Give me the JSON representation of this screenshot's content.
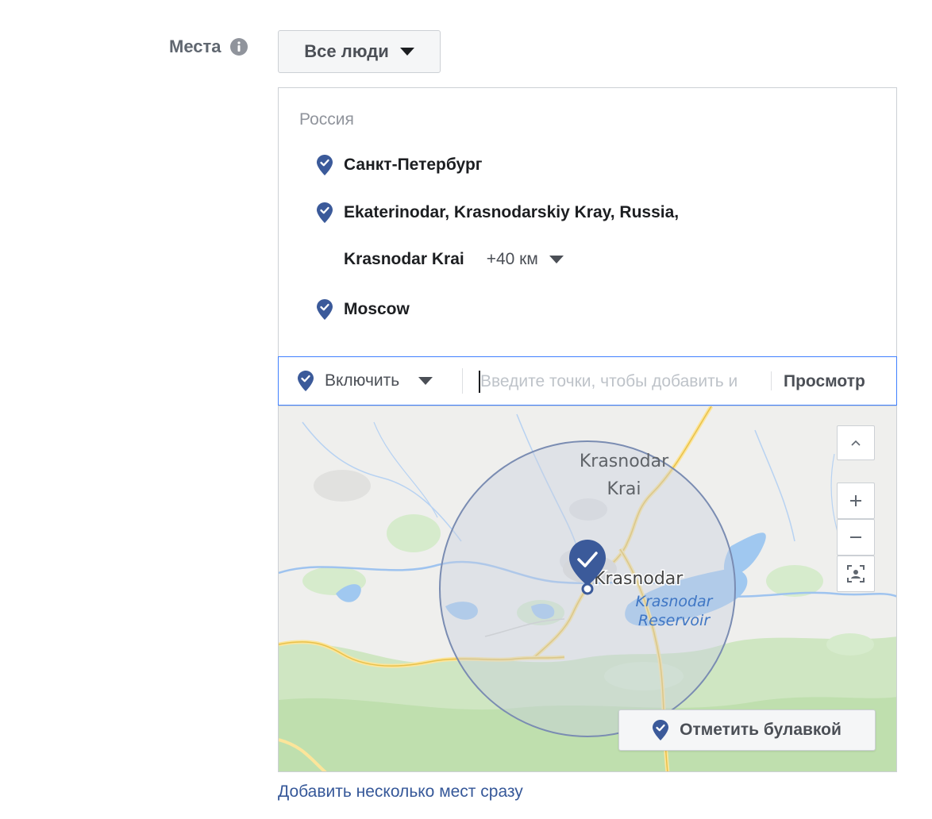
{
  "field": {
    "label": "Места"
  },
  "audience": {
    "selected": "Все люди"
  },
  "locations": {
    "country": "Россия",
    "items": [
      {
        "text": "Санкт-Петербург"
      },
      {
        "text": "Ekaterinodar, Krasnodarskiy Kray, Russia,",
        "text_cont": "Krasnodar Krai",
        "radius": "+40 км"
      },
      {
        "text": "Moscow"
      }
    ]
  },
  "search": {
    "include_label": "Включить",
    "placeholder": "Введите точки, чтобы добавить и",
    "browse_label": "Просмотр"
  },
  "map": {
    "labels": {
      "region_line1": "Krasnodar",
      "region_line2": "Krai",
      "city": "Krasnodar",
      "reservoir_line1": "Krasnodar",
      "reservoir_line2": "Reservoir"
    },
    "drop_pin_label": "Отметить булавкой"
  },
  "bulk_link": "Добавить несколько мест сразу",
  "colors": {
    "accent": "#4267b2",
    "pin": "#3b5a9a",
    "link": "#365899",
    "focus_border": "#4080ff"
  }
}
